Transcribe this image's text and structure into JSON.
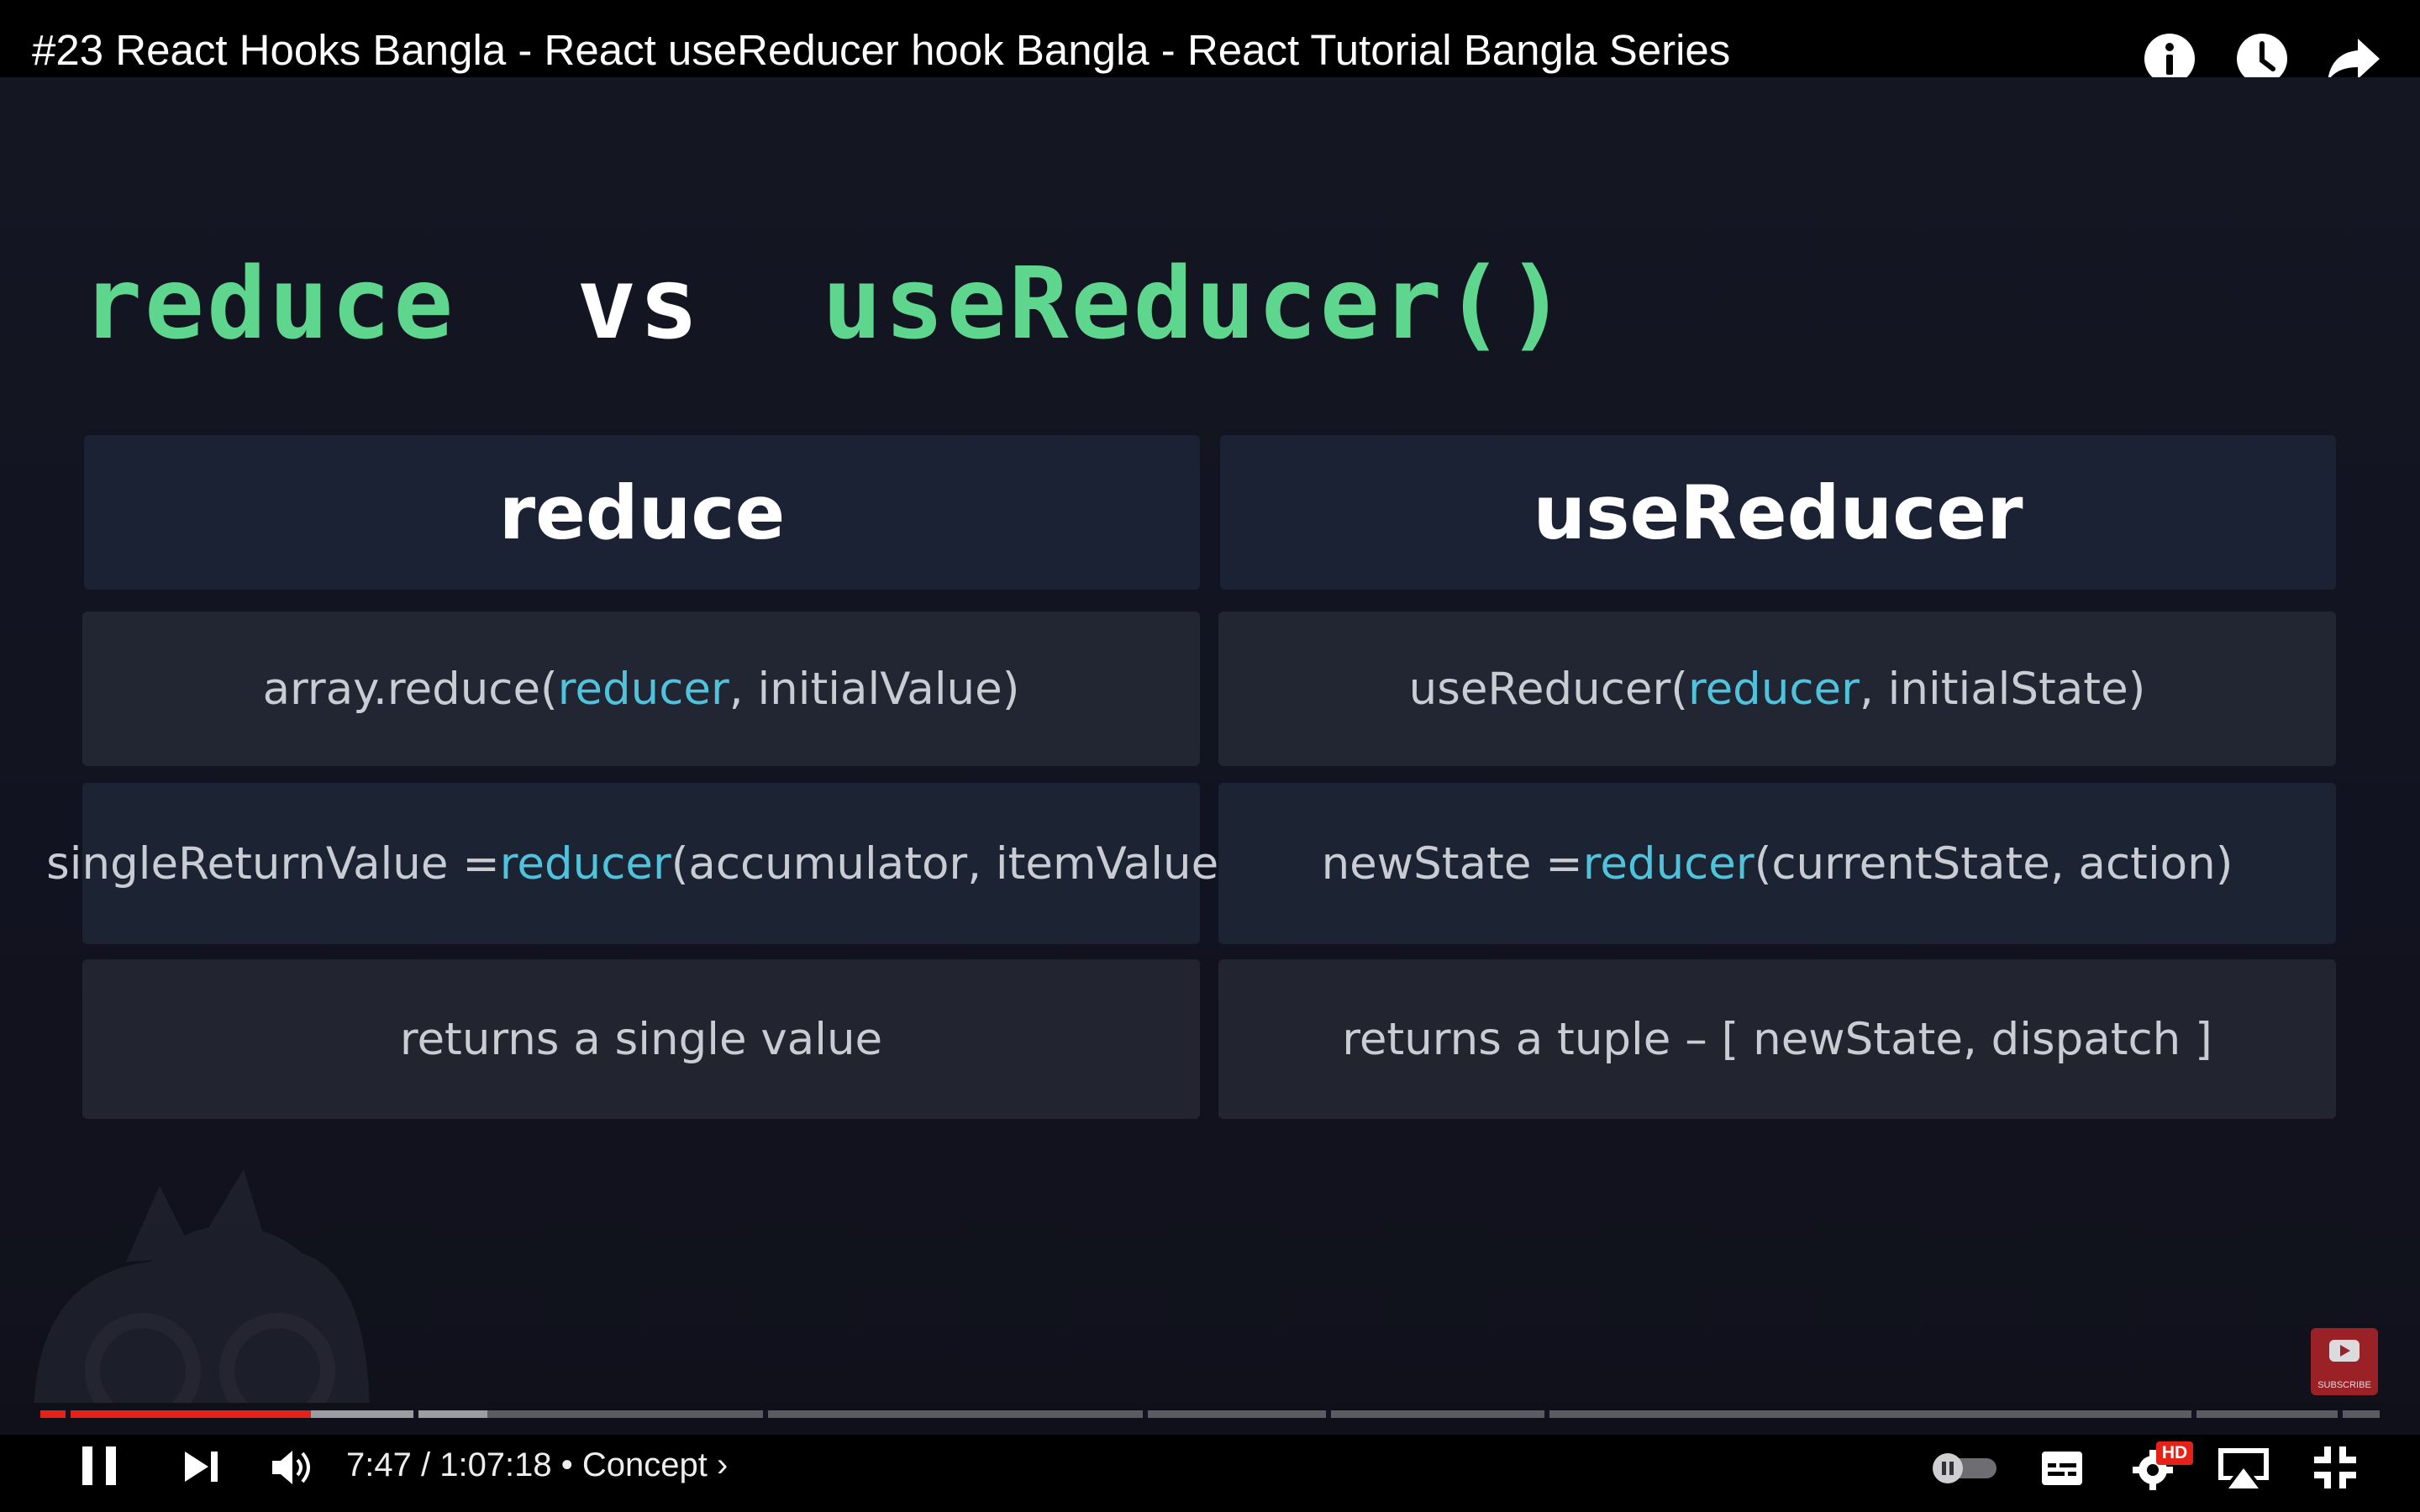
{
  "header": {
    "video_title": "#23 React Hooks Bangla - React useReducer hook Bangla - React Tutorial Bangla Series",
    "icons": [
      "info-icon",
      "watch-later-icon",
      "share-icon"
    ]
  },
  "slide": {
    "heading": {
      "part1": "reduce",
      "part2": "vs",
      "part3": "useReducer()"
    },
    "columns": [
      {
        "header": "reduce",
        "rows": [
          {
            "before": "array.reduce(",
            "keyword": "reducer",
            "after": ", initialValue)"
          },
          {
            "before": "singleReturnValue = ",
            "keyword": "reducer",
            "after": "(accumulator, itemValue)"
          },
          {
            "before": "returns a single value",
            "keyword": "",
            "after": ""
          }
        ]
      },
      {
        "header": "useReducer",
        "rows": [
          {
            "before": "useReducer(",
            "keyword": "reducer",
            "after": ", initialState)"
          },
          {
            "before": "newState = ",
            "keyword": "reducer",
            "after": "(currentState, action)"
          },
          {
            "before": "returns a tuple – [ newState, dispatch ]",
            "keyword": "",
            "after": ""
          }
        ]
      }
    ],
    "subscribe_label": "SUBSCRIBE"
  },
  "player": {
    "current_time": "7:47",
    "separator": " / ",
    "duration": "1:07:18",
    "chapter_dot": " • ",
    "chapter": "Concept",
    "chapter_chevron": "›",
    "progress_fraction": 0.1156,
    "hd_badge": "HD",
    "colors": {
      "played": "#e62117",
      "accent_green": "#5fd68e",
      "keyword_blue": "#4fc3dc"
    }
  }
}
